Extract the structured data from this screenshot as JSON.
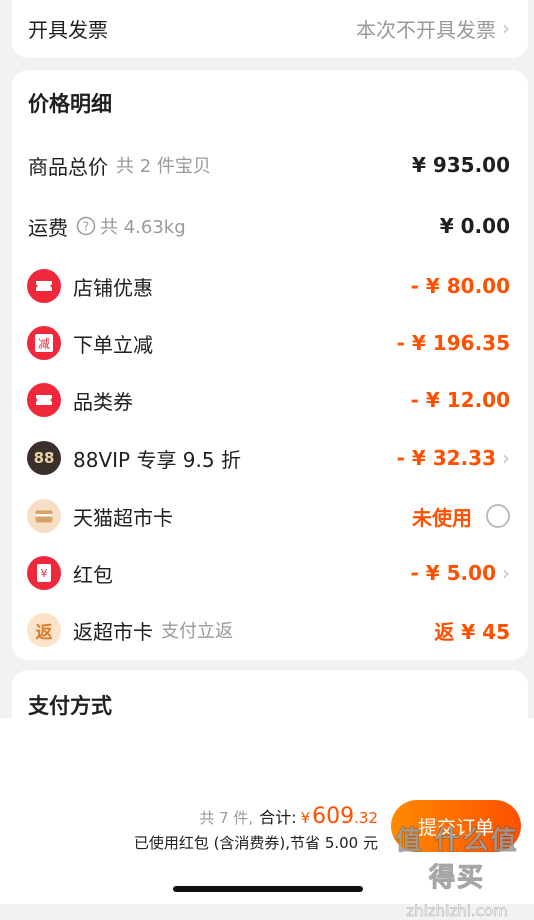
{
  "invoice": {
    "label": "开具发票",
    "value": "本次不开具发票"
  },
  "price": {
    "title": "价格明细",
    "rows": [
      {
        "label": "商品总价",
        "sub": "共 2 件宝贝",
        "value": "¥ 935.00"
      },
      {
        "label": "运费",
        "sub": "共 4.63kg",
        "value": "¥ 0.00"
      },
      {
        "label": "店铺优惠",
        "value": "- ¥ 80.00"
      },
      {
        "label": "下单立减",
        "value": "- ¥ 196.35",
        "icon_text": "减"
      },
      {
        "label": "品类券",
        "value": "- ¥ 12.00"
      },
      {
        "label": "88VIP 专享 9.5 折",
        "value": "- ¥ 32.33",
        "icon_text": "88"
      },
      {
        "label": "天猫超市卡",
        "value": "未使用"
      },
      {
        "label": "红包",
        "value": "- ¥ 5.00",
        "icon_text": "¥"
      },
      {
        "label": "返超市卡",
        "sub": "支付立返",
        "value": "返 ¥ 45",
        "icon_text": "返"
      }
    ]
  },
  "payment": {
    "title": "支付方式"
  },
  "footer": {
    "count": "共 7 件,",
    "total_label": "合计:",
    "currency": "¥",
    "total_int": "609",
    "total_dec": ".32",
    "note": "已使用红包 (含消费券),节省 5.00 元",
    "submit": "提交订单"
  },
  "watermark": {
    "text": "值 什么值得买",
    "url": "zhizhizhi.com"
  },
  "colors": {
    "accent": "#ff5000",
    "red": "#f0283c",
    "vip": "#3a2f2a"
  },
  "icons": [
    "ticket-icon",
    "reduce-icon",
    "ticket-icon",
    "vip-88-icon",
    "card-icon",
    "red-packet-icon",
    "return-icon",
    "help-circle-icon",
    "chevron-right-icon",
    "radio-icon"
  ]
}
